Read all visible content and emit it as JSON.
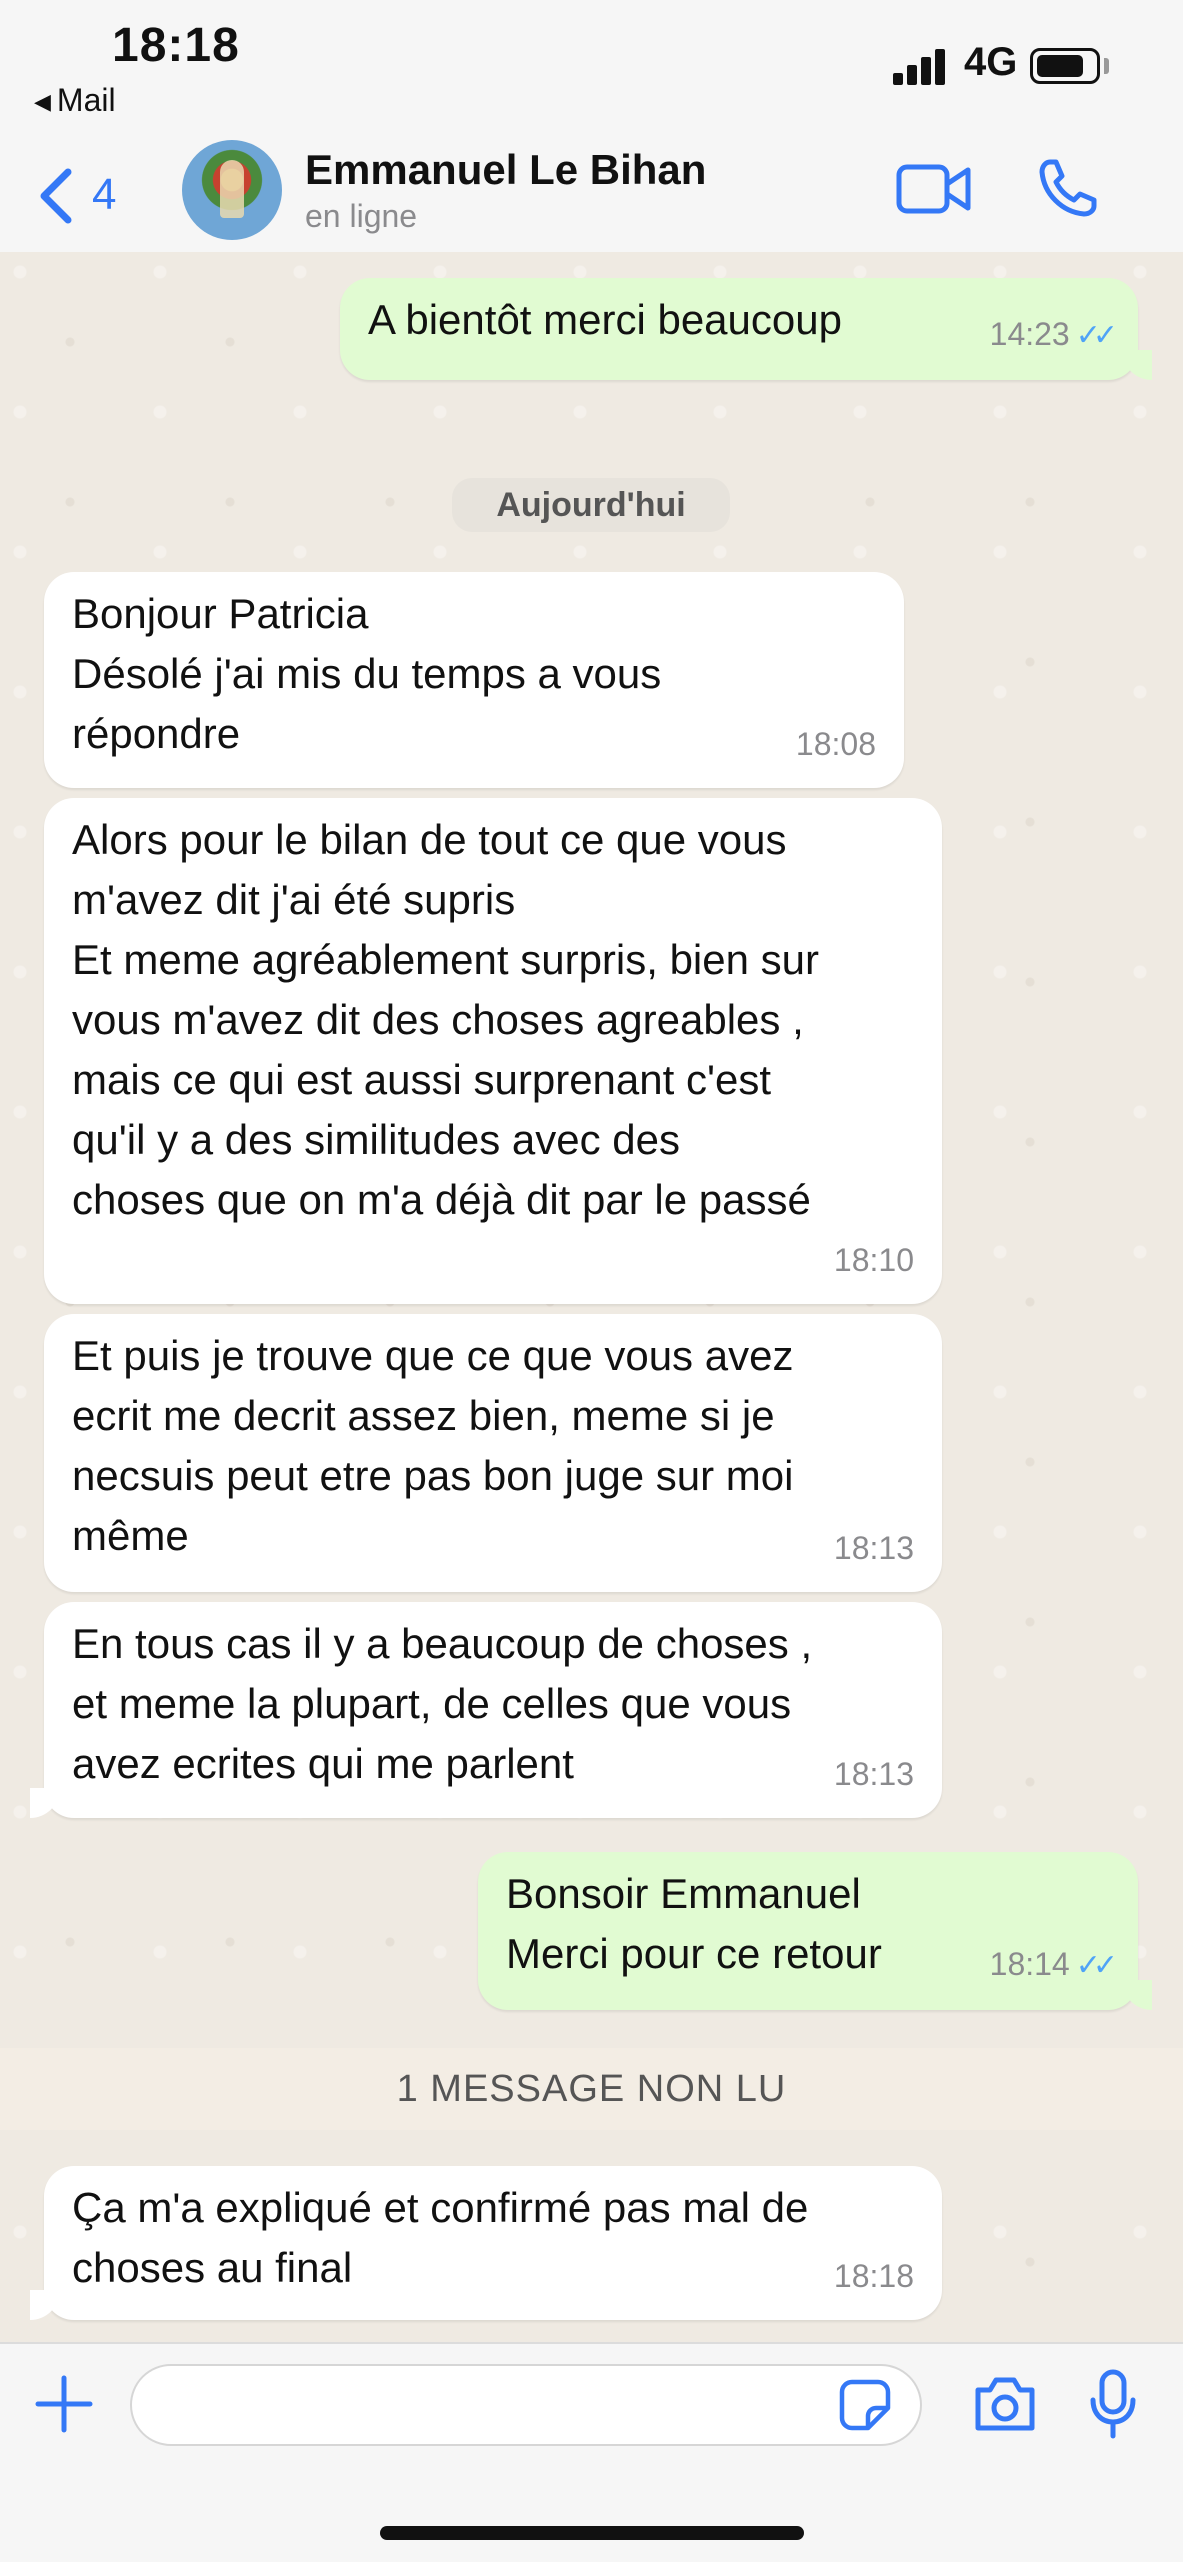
{
  "status_bar": {
    "time": "18:18",
    "back_app": "Mail",
    "network": "4G",
    "battery_level": 0.8
  },
  "header": {
    "back_count": "4",
    "contact_name": "Emmanuel Le Bihan",
    "contact_status": "en ligne",
    "video_icon": "video-camera-icon",
    "call_icon": "phone-icon"
  },
  "chat": {
    "date_separator": "Aujourd'hui",
    "unread_banner": "1 MESSAGE NON LU",
    "messages": [
      {
        "direction": "out",
        "text": "A bientôt merci beaucoup",
        "time": "14:23",
        "read": true
      },
      {
        "direction": "in",
        "text": "Bonjour Patricia\nDésolé j'ai mis du temps a vous\nrépondre",
        "time": "18:08"
      },
      {
        "direction": "in",
        "text": "Alors pour le bilan de tout ce que vous\nm'avez dit j'ai été supris\nEt meme agréablement surpris, bien sur\nvous m'avez dit des choses agreables ,\nmais ce qui est aussi surprenant c'est\nqu'il y a des similitudes avec des\nchoses que on m'a déjà dit par le passé",
        "time": "18:10"
      },
      {
        "direction": "in",
        "text": "Et puis je trouve que ce que vous avez\necrit me decrit assez bien, meme si je\nnecsuis peut etre pas bon juge sur moi\nmême",
        "time": "18:13"
      },
      {
        "direction": "in",
        "text": "En tous cas il y a beaucoup de choses ,\net meme la plupart, de celles que vous\navez ecrites qui me parlent",
        "time": "18:13"
      },
      {
        "direction": "out",
        "text": "Bonsoir Emmanuel\nMerci pour ce retour",
        "time": "18:14",
        "read": true
      },
      {
        "direction": "in",
        "text": "Ça m'a expliqué et confirmé pas mal de\nchoses au final",
        "time": "18:18"
      }
    ]
  },
  "input_bar": {
    "value": "",
    "placeholder": ""
  },
  "colors": {
    "accent": "#3478f6",
    "outgoing_bubble": "#e1fbd2",
    "incoming_bubble": "#ffffff",
    "chat_background": "#efeae2",
    "read_ticks": "#4fa3f7"
  }
}
